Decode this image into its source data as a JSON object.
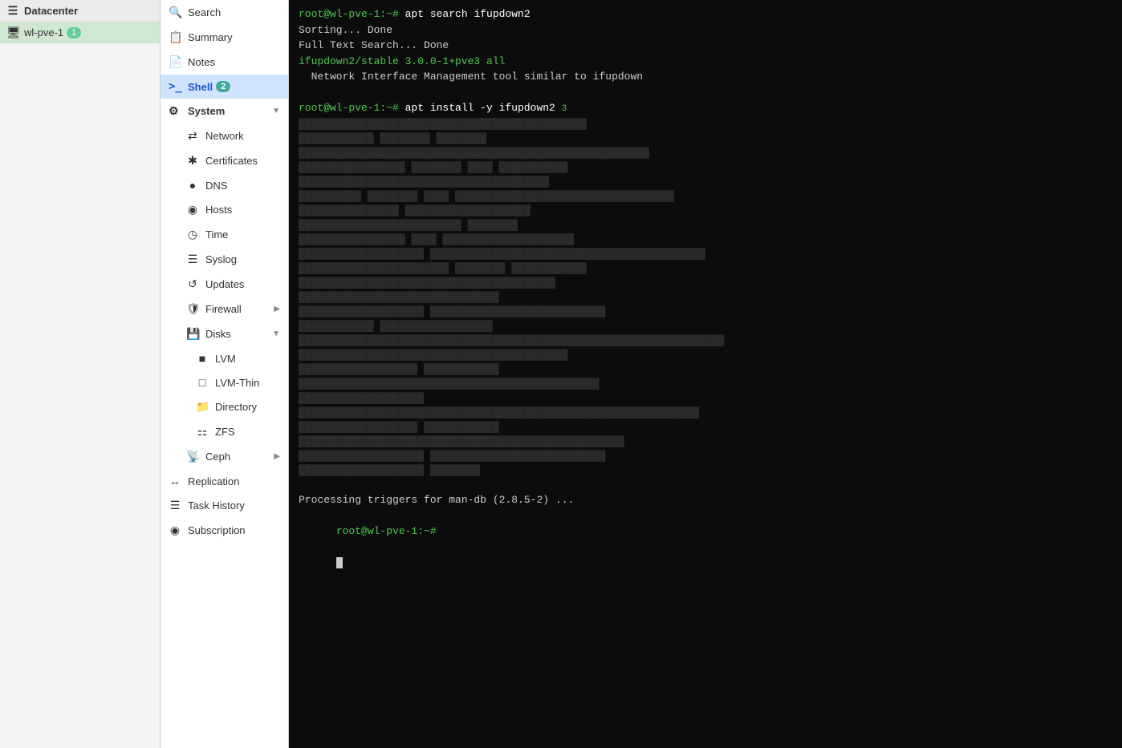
{
  "tree": {
    "datacenter_label": "Datacenter",
    "node_label": "wl-pve-1",
    "node_badge": "1"
  },
  "nav": {
    "items": [
      {
        "id": "search",
        "label": "Search",
        "icon": "🔍",
        "active": false,
        "badge": null,
        "type": "item"
      },
      {
        "id": "summary",
        "label": "Summary",
        "icon": "📋",
        "active": false,
        "badge": null,
        "type": "item"
      },
      {
        "id": "notes",
        "label": "Notes",
        "icon": "📄",
        "active": false,
        "badge": null,
        "type": "item"
      },
      {
        "id": "shell",
        "label": "Shell",
        "icon": ">_",
        "active": true,
        "badge": "2",
        "type": "item"
      },
      {
        "id": "system",
        "label": "System",
        "icon": "⚙",
        "active": false,
        "badge": null,
        "type": "section",
        "expanded": true,
        "children": [
          {
            "id": "network",
            "label": "Network",
            "icon": "⇄"
          },
          {
            "id": "certificates",
            "label": "Certificates",
            "icon": "✱"
          },
          {
            "id": "dns",
            "label": "DNS",
            "icon": "●"
          },
          {
            "id": "hosts",
            "label": "Hosts",
            "icon": "◉"
          },
          {
            "id": "time",
            "label": "Time",
            "icon": "◷"
          },
          {
            "id": "syslog",
            "label": "Syslog",
            "icon": "☰"
          },
          {
            "id": "updates",
            "label": "Updates",
            "icon": "↺"
          },
          {
            "id": "firewall",
            "label": "Firewall",
            "icon": "🛡",
            "hasArrow": true
          },
          {
            "id": "disks",
            "label": "Disks",
            "icon": "💾",
            "hasArrow": true,
            "subExpanded": true,
            "sub": [
              {
                "id": "lvm",
                "label": "LVM",
                "icon": "■"
              },
              {
                "id": "lvm-thin",
                "label": "LVM-Thin",
                "icon": "□"
              },
              {
                "id": "directory",
                "label": "Directory",
                "icon": "📁"
              },
              {
                "id": "zfs",
                "label": "ZFS",
                "icon": "⚏"
              }
            ]
          },
          {
            "id": "ceph",
            "label": "Ceph",
            "icon": "📡",
            "hasArrow": true
          }
        ]
      },
      {
        "id": "replication",
        "label": "Replication",
        "icon": "↔",
        "active": false,
        "badge": null,
        "type": "item"
      },
      {
        "id": "task-history",
        "label": "Task History",
        "icon": "☰",
        "active": false,
        "badge": null,
        "type": "item"
      },
      {
        "id": "subscription",
        "label": "Subscription",
        "icon": "◉",
        "active": false,
        "badge": null,
        "type": "item"
      }
    ]
  },
  "terminal": {
    "lines": [
      {
        "type": "prompt",
        "text": "root@wl-pve-1:~# apt search ifupdown2"
      },
      {
        "type": "normal",
        "text": "Sorting... Done"
      },
      {
        "type": "normal",
        "text": "Full Text Search... Done"
      },
      {
        "type": "green",
        "text": "ifupdown2/stable 3.0.0-1+pve3 all"
      },
      {
        "type": "normal",
        "text": "  Network Interface Management tool similar to ifupdown"
      },
      {
        "type": "empty",
        "text": ""
      },
      {
        "type": "prompt",
        "text": "root@wl-pve-1:~# apt install -y ifupdown2 "
      },
      {
        "type": "blurred",
        "text": "                                                                                        "
      },
      {
        "type": "blurred",
        "text": "                                                                                        "
      },
      {
        "type": "blurred",
        "text": "                                                                                        "
      },
      {
        "type": "blurred",
        "text": "                                                                                        "
      },
      {
        "type": "blurred",
        "text": "                                                                                        "
      },
      {
        "type": "blurred",
        "text": "                                                                                        "
      },
      {
        "type": "blurred",
        "text": "                                                                                        "
      },
      {
        "type": "blurred",
        "text": "                                                                                        "
      },
      {
        "type": "blurred",
        "text": "                                                                                        "
      },
      {
        "type": "blurred",
        "text": "                                                                                        "
      },
      {
        "type": "blurred",
        "text": "                                                                                        "
      },
      {
        "type": "blurred",
        "text": "                                                                                        "
      },
      {
        "type": "blurred",
        "text": "                                                                                        "
      },
      {
        "type": "blurred",
        "text": "                                                                                        "
      },
      {
        "type": "blurred",
        "text": "                                                                                        "
      },
      {
        "type": "blurred",
        "text": "                                                                                        "
      },
      {
        "type": "blurred",
        "text": "                                                                                        "
      },
      {
        "type": "blurred",
        "text": "                                                                                        "
      },
      {
        "type": "blurred",
        "text": "                                                                                        "
      },
      {
        "type": "blurred",
        "text": "                                                                                        "
      },
      {
        "type": "blurred",
        "text": "                                                                                        "
      },
      {
        "type": "empty",
        "text": ""
      },
      {
        "type": "normal",
        "text": "Processing triggers for man-db (2.8.5-2) ..."
      },
      {
        "type": "prompt-end",
        "text": "root@wl-pve-1:~#"
      }
    ]
  }
}
